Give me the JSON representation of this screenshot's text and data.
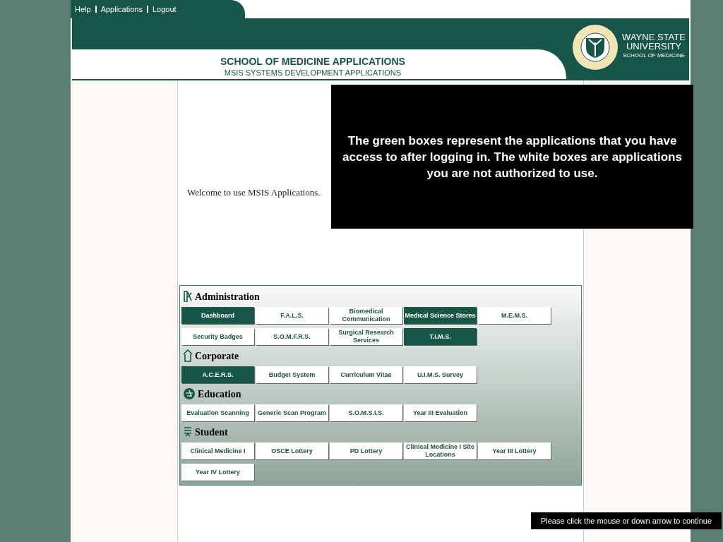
{
  "nav": [
    "Help",
    "Applications",
    "Logout"
  ],
  "header": {
    "title": "SCHOOL OF MEDICINE APPLICATIONS",
    "subtitle": "MSIS SYSTEMS DEVELOPMENT APPLICATIONS"
  },
  "logo": {
    "line1": "WAYNE STATE",
    "line2": "UNIVERSITY",
    "line3": "SCHOOL OF MEDICINE"
  },
  "welcome": "Welcome to use MSIS Applications.",
  "sections": [
    {
      "title": "Administration",
      "kind": "admin",
      "apps": [
        {
          "label": "Dashboard",
          "access": true
        },
        {
          "label": "F.A.L.S.",
          "access": false
        },
        {
          "label": "Biomedical Communication",
          "access": false
        },
        {
          "label": "Medical Science Stores",
          "access": true
        },
        {
          "label": "M.E.M.S.",
          "access": false
        },
        {
          "label": "Security Badges",
          "access": false
        },
        {
          "label": "S.O.M.F.R.S.",
          "access": false
        },
        {
          "label": "Surgical Research Services",
          "access": false
        },
        {
          "label": "T.I.M.S.",
          "access": true
        }
      ]
    },
    {
      "title": "Corporate",
      "kind": "corporate",
      "apps": [
        {
          "label": "A.C.E.R.S.",
          "access": true
        },
        {
          "label": "Budget System",
          "access": false
        },
        {
          "label": "Curriculum Vitae",
          "access": false
        },
        {
          "label": "U.I.M.S. Survey",
          "access": false
        }
      ]
    },
    {
      "title": "Education",
      "kind": "education",
      "apps": [
        {
          "label": "Evaluation Scanning",
          "access": false
        },
        {
          "label": "Generic Scan Program",
          "access": false
        },
        {
          "label": "S.O.M.S.I.S.",
          "access": false
        },
        {
          "label": "Year III Evaluation",
          "access": false
        }
      ]
    },
    {
      "title": "Student",
      "kind": "student",
      "apps": [
        {
          "label": "Clinical Medicine I",
          "access": false
        },
        {
          "label": "OSCE Lottery",
          "access": false
        },
        {
          "label": "PD Lottery",
          "access": false
        },
        {
          "label": "Clinical Medicine I Site Locations",
          "access": false
        },
        {
          "label": "Year III Lottery",
          "access": false
        },
        {
          "label": "Year IV Lottery",
          "access": false
        }
      ]
    }
  ],
  "callout": "The green boxes represent the applications that you have access to after logging in. The white boxes are applications you are not authorized to use.",
  "continue_hint": "Please click the mouse or down arrow to continue"
}
